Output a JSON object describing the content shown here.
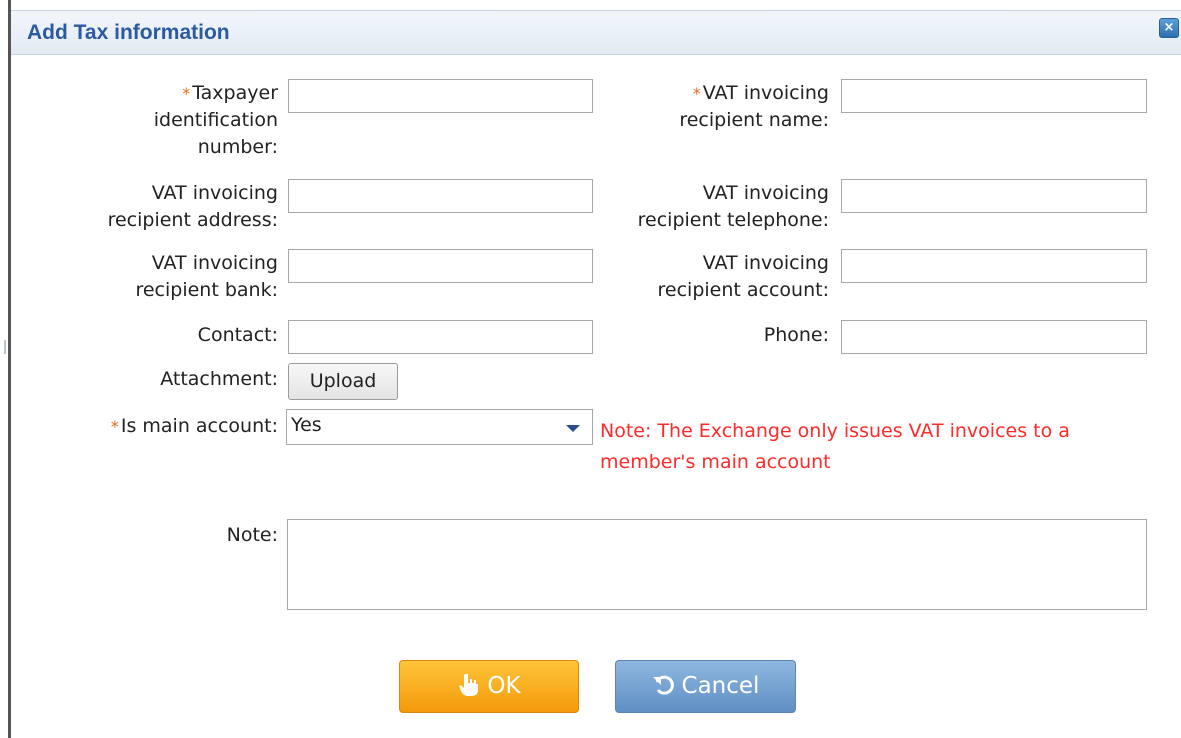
{
  "dialog": {
    "title": "Add Tax information",
    "close_glyph": "×"
  },
  "form": {
    "required_mark": "*",
    "taxpayer_id": {
      "label_lines": [
        "Taxpayer",
        "identification",
        "number:"
      ],
      "value": ""
    },
    "recipient_name": {
      "label_lines": [
        "VAT invoicing",
        "recipient name:"
      ],
      "value": ""
    },
    "recipient_address": {
      "label_lines": [
        "VAT invoicing",
        "recipient address:"
      ],
      "value": ""
    },
    "recipient_telephone": {
      "label_lines": [
        "VAT invoicing",
        "recipient telephone:"
      ],
      "value": ""
    },
    "recipient_bank": {
      "label_lines": [
        "VAT invoicing",
        "recipient bank:"
      ],
      "value": ""
    },
    "recipient_account": {
      "label_lines": [
        "VAT invoicing",
        "recipient account:"
      ],
      "value": ""
    },
    "contact": {
      "label": "Contact:",
      "value": ""
    },
    "phone": {
      "label": "Phone:",
      "value": ""
    },
    "attachment": {
      "label": "Attachment:",
      "button_label": "Upload"
    },
    "is_main_account": {
      "label": "Is main account:",
      "selected": "Yes",
      "note": "Note: The Exchange only issues VAT invoices to a member's main account"
    },
    "note": {
      "label": "Note:",
      "value": ""
    }
  },
  "buttons": {
    "ok_label": "OK",
    "cancel_label": "Cancel"
  },
  "colors": {
    "title": "#2c5aa0",
    "required": "#e56a17",
    "warning": "#ff2a2a",
    "ok_button": "#f7a81b",
    "cancel_button": "#79a5d4"
  }
}
